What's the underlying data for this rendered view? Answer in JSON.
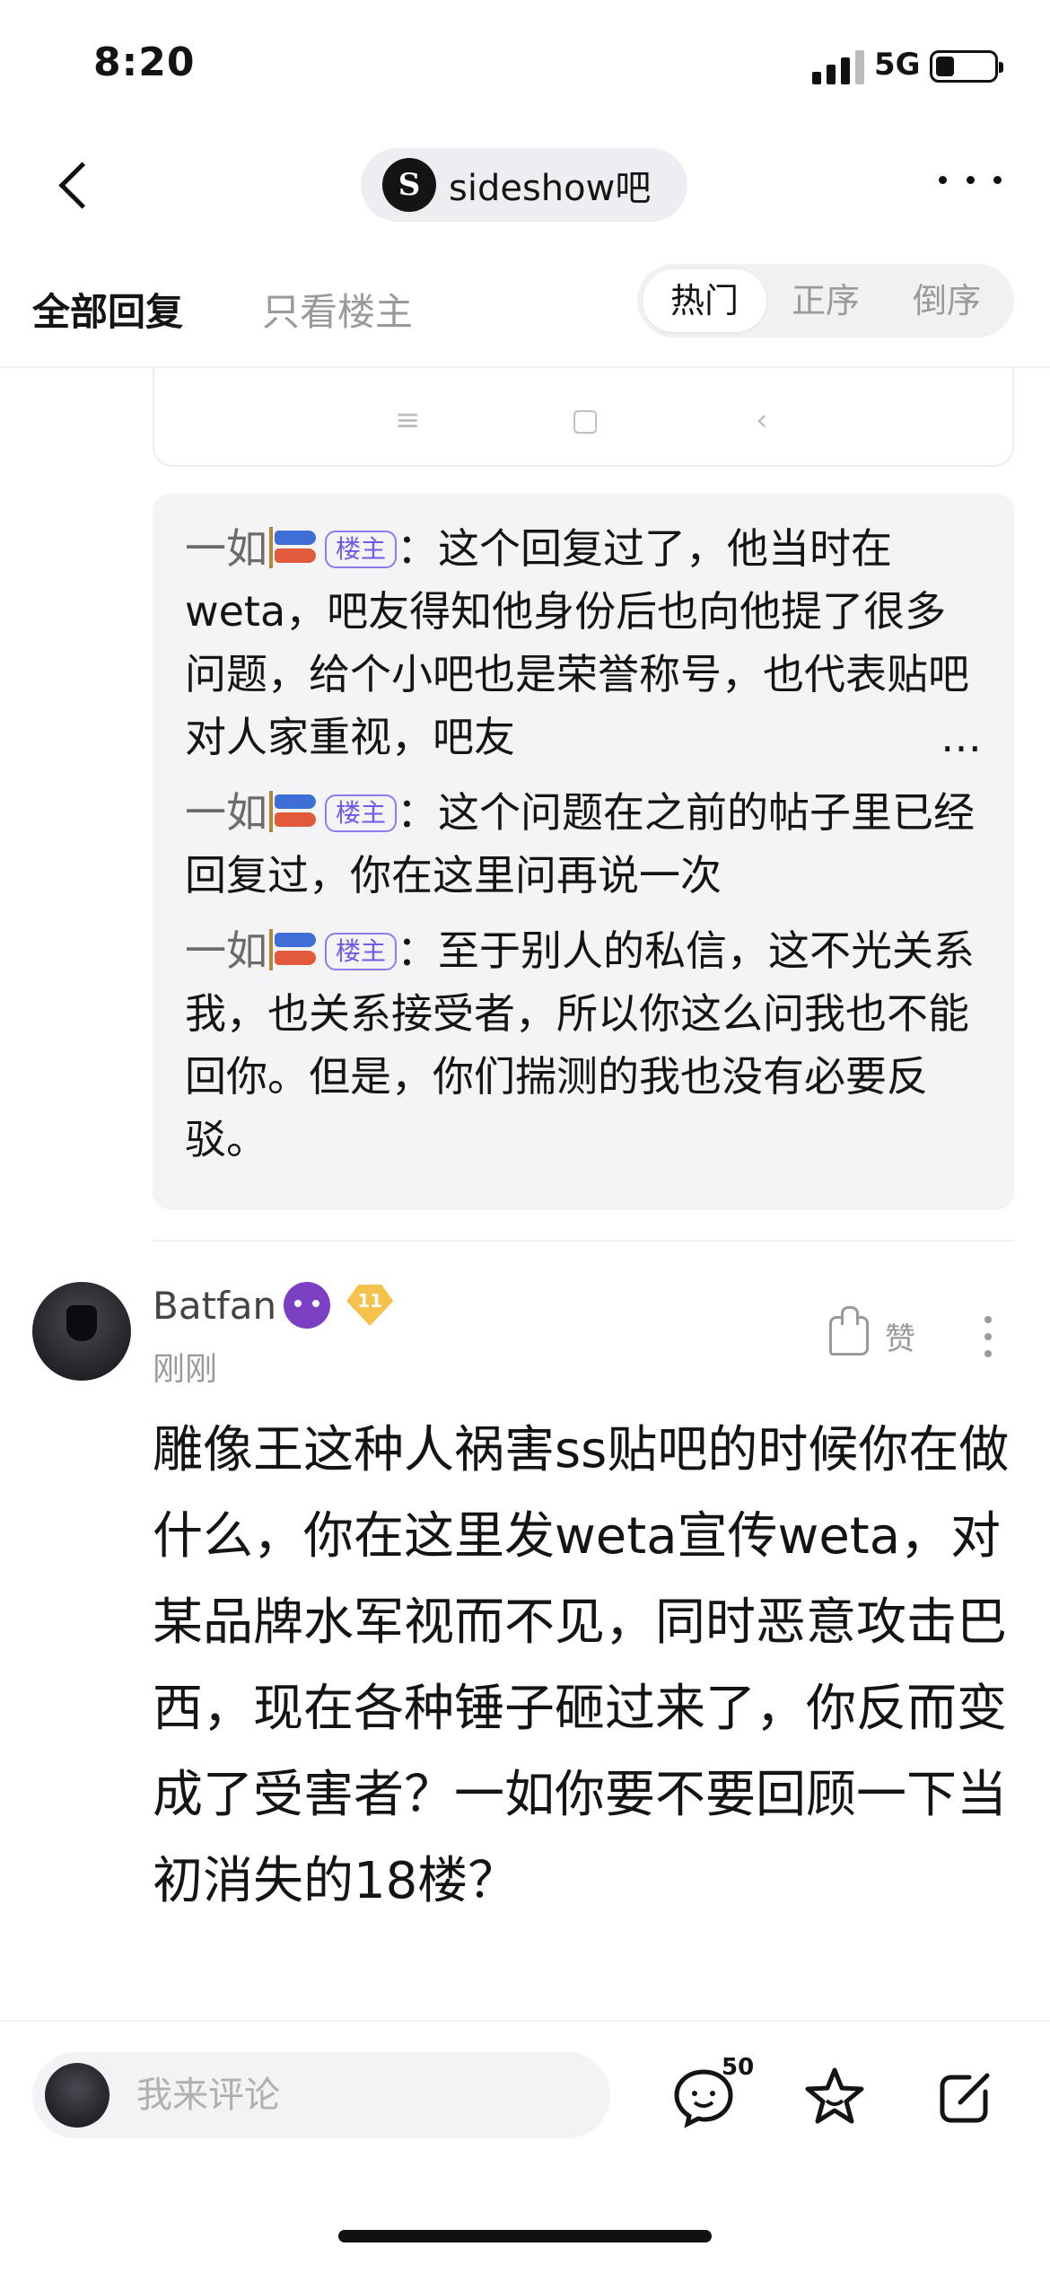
{
  "status_bar": {
    "time": "8:20",
    "network": "5G",
    "battery_level": 0.25
  },
  "nav": {
    "forum_logo_text": "S",
    "forum_name": "sideshow吧"
  },
  "filter": {
    "tab_all": "全部回复",
    "tab_op_only": "只看楼主",
    "sort_options": [
      "热门",
      "正序",
      "倒序"
    ],
    "sort_active": "热门"
  },
  "partial_card": {
    "icons": [
      "≡",
      "▢",
      "‹"
    ]
  },
  "sub_replies": [
    {
      "author": "一如",
      "badge": "楼主",
      "text": "：这个回复过了，他当时在weta，吧友得知他身份后也向他提了很多问题，给个小吧也是荣誉称号，也代表贴吧对人家重视，吧友"
    },
    {
      "author": "一如",
      "badge": "楼主",
      "text": "：这个问题在之前的帖子里已经回复过，你在这里问再说一次"
    },
    {
      "author": "一如",
      "badge": "楼主",
      "text": "：至于别人的私信，这不光关系我，也关系接受者，所以你这么问我也不能回你。但是，你们揣测的我也没有必要反驳。"
    }
  ],
  "comment": {
    "username": "Batfan",
    "emoji": "devil-emoji",
    "level": "11",
    "time": "刚刚",
    "like_label": "赞",
    "body": "雕像王这种人祸害ss贴吧的时候你在做什么，你在这里发weta宣传weta，对某品牌水军视而不见，同时恶意攻击巴西，现在各种锤子砸过来了，你反而变成了受害者？一如你要不要回顾一下当初消失的18楼？"
  },
  "bottom_bar": {
    "input_placeholder": "我来评论",
    "comment_count": "50",
    "icons": [
      "comment-icon",
      "favorite-star-icon",
      "share-edit-icon"
    ]
  }
}
